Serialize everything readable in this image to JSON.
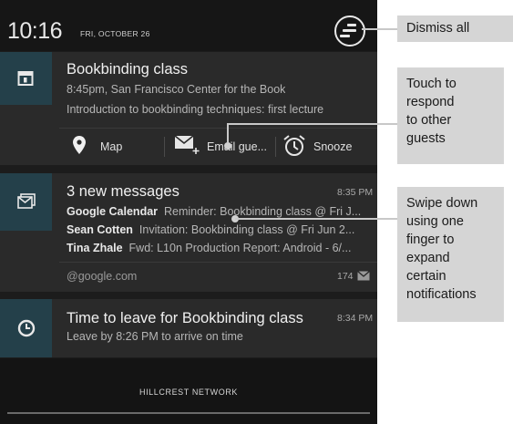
{
  "status": {
    "time": "10:16",
    "date": "FRI, OCTOBER 26"
  },
  "calendar": {
    "title": "Bookbinding class",
    "line1": "8:45pm, San Francisco Center for the Book",
    "line2": "Introduction to bookbinding techniques: first lecture",
    "actions": {
      "map": "Map",
      "email": "Email gue...",
      "snooze": "Snooze"
    }
  },
  "gmail": {
    "title": "3 new messages",
    "time": "8:35 PM",
    "messages": [
      {
        "sender": "Google Calendar",
        "text": "Reminder: Bookbinding class @ Fri J..."
      },
      {
        "sender": "Sean Cotten",
        "text": "Invitation: Bookbinding class @ Fri Jun 2..."
      },
      {
        "sender": "Tina Zhale",
        "text": "Fwd: L10n Production Report: Android - 6/..."
      }
    ],
    "account": "@google.com",
    "count": "174"
  },
  "reminder": {
    "title": "Time to leave for Bookbinding class",
    "subtitle": "Leave by 8:26 PM to arrive on time",
    "time": "8:34 PM"
  },
  "bottom": {
    "network": "HILLCREST NETWORK"
  },
  "callouts": {
    "dismiss": "Dismiss all",
    "touch": [
      "Touch to",
      "respond",
      "to other",
      "guests"
    ],
    "swipe": [
      "Swipe down",
      "using one",
      "finger to",
      "expand",
      "certain",
      "notifications"
    ]
  },
  "colors": {
    "icon_bg": "#24404a",
    "panel": "#2a2a2a",
    "background": "#1c1c1c"
  }
}
